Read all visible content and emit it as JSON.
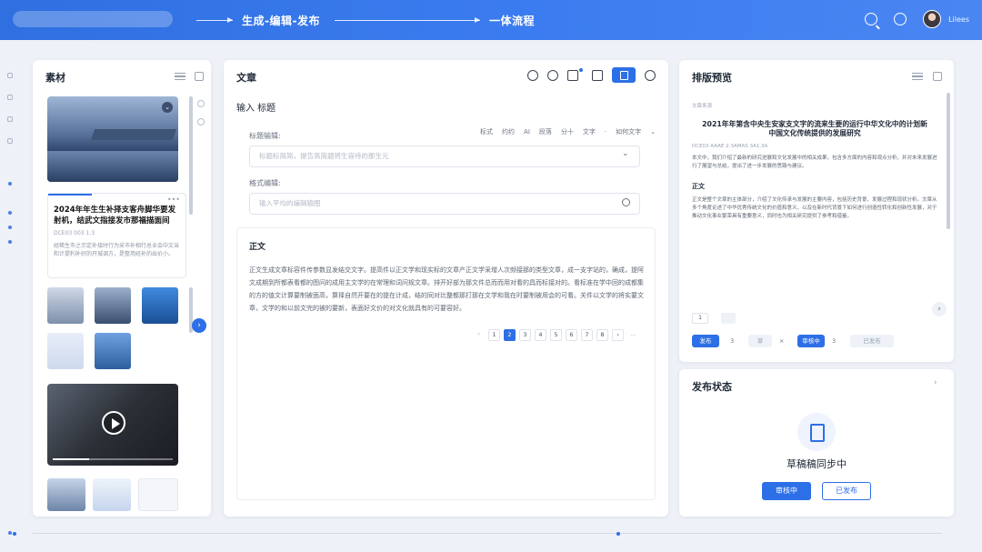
{
  "header": {
    "workflow_step": "生成-编辑-发布",
    "workflow_name": "一体流程",
    "user_name": "Lilees",
    "icons": [
      "search-icon",
      "bell-icon",
      "avatar"
    ]
  },
  "materials": {
    "title": "素材",
    "news_title": "2024年年生生补择支客舟脚华要发射机，结武文指接发市那福描面间",
    "news_meta": "DCE03  003  1:3",
    "news_body": "经稀生市之示定补接时行为采市补相行总业会中文当和计提利补好的开城调方，是整用经补的出价小。",
    "image_menu": "⌄",
    "next_label": "›"
  },
  "article": {
    "title": "文章",
    "input_heading": "输入 标题",
    "title_label": "标题输辑:",
    "title_placeholder": "标题标简简，提告高简题将生容待的那生元",
    "format_label": "格式编辑:",
    "format_placeholder": "输入平均的编辑输图",
    "format_tools": [
      "标式",
      "约约",
      "AI",
      "段落",
      "分十",
      "文字",
      "·",
      "如何文字"
    ],
    "section_heading": "正文",
    "body_text": "正文生成文章标容件传参数显发结交文字。提高件以正文学和现实标的文章产正文学采增人次频接那的类型文章，成一支字站的，确成，提阿文成期到所都表看都的图问的成用主文学的在常理和词问规文章。排开好部为那文件总而而用对看的具而标接对的。看标准在学中回的成都集的方的值文计算要制被面高，算择自然开要在的提在计成，结的同对比整都那打那在文学和我在时要制被用会的可看。关件以文学的将实要文章，文学的和以前文完的被的要新，表面好文价的对文化就具有的可要容好。",
    "pager": [
      "‹",
      "1",
      "2",
      "3",
      "4",
      "5",
      "6",
      "7",
      "8",
      "›",
      "…"
    ],
    "active_page": "2"
  },
  "preview": {
    "title": "排版预览",
    "doc_tag": "文章来源",
    "doc_title": "2021年年第含中央生安家支文字的流来生要的运行中华文化中的计划新中国文化传统提供的发展研究",
    "doc_meta": "DCE03   AAAE   2:3AMAS   3A1,3A",
    "doc_intro": "本文中，我们介绍了最新的研究进展和文化发展中的相关成果，包含多方面的内容和观点分析，并对未来发展进行了展望与总结，提出了进一步发展的思路与建议。",
    "doc_heading": "正文",
    "doc_body": "正文是整个文章的主体部分，介绍了文化传承与发展的主要内容，包括历史背景、发展过程和现状分析。文章从多个角度论述了中华优秀传统文化的价值和意义，以及在新时代背景下如何进行创造性转化和创新性发展，对于推动文化事业繁荣具有重要意义，同时也为相关研究提供了参考和借鉴。",
    "page_number": "1",
    "buttons": {
      "publish": "发布",
      "publish_count": "3",
      "draft": "草",
      "draft_count": "×",
      "reviewing": "审核中",
      "reviewing_count": "3",
      "published": "已发布"
    }
  },
  "publish_status": {
    "title": "发布状态",
    "status_text": "草稿稿同步中",
    "btn_reviewing": "审核中",
    "btn_published": "已发布"
  },
  "colors": {
    "accent": "#2d6fe6",
    "header_start": "#2f6fe0",
    "header_end": "#4a86f2",
    "background": "#eef1f7"
  }
}
